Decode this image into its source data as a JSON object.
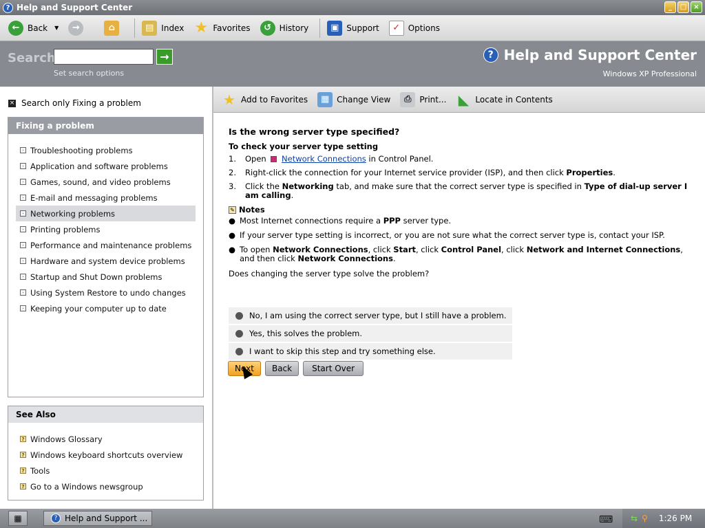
{
  "window": {
    "title": "Help and Support Center"
  },
  "toolbar": {
    "back": "Back",
    "index": "Index",
    "favorites": "Favorites",
    "history": "History",
    "support": "Support",
    "options": "Options"
  },
  "search": {
    "label": "Search",
    "placeholder": "",
    "set_options": "Set search options",
    "app_title": "Help and Support Center",
    "app_sub": "Windows XP Professional"
  },
  "left": {
    "only_check": "Search only Fixing a problem",
    "section_title": "Fixing a problem",
    "items": [
      "Troubleshooting problems",
      "Application and software problems",
      "Games, sound, and video problems",
      "E-mail and messaging problems",
      "Networking problems",
      "Printing problems",
      "Performance and maintenance problems",
      "Hardware and system device problems",
      "Startup and Shut Down problems",
      "Using System Restore to undo changes",
      "Keeping your computer up to date"
    ],
    "see_also_title": "See Also",
    "see_also": [
      "Windows Glossary",
      "Windows keyboard shortcuts overview",
      "Tools",
      "Go to a Windows newsgroup"
    ]
  },
  "content_toolbar": {
    "add_fav": "Add to Favorites",
    "change_view": "Change View",
    "print": "Print...",
    "locate": "Locate in Contents"
  },
  "article": {
    "title": "Is the wrong server type specified?",
    "subtitle": "To check your server type setting",
    "step1_pre": "Open",
    "step1_link": "Network Connections",
    "step1_post": "in Control Panel.",
    "step2_pre": "Right-click the connection for your Internet service provider (ISP), and then click",
    "step2_bold": "Properties",
    "step3_a": "Click the",
    "step3_b": "Networking",
    "step3_c": "tab, and make sure that the correct server type is specified in",
    "step3_d": "Type of dial-up server I am calling",
    "notes": "Notes",
    "note1_a": "Most Internet connections require a",
    "note1_b": "PPP",
    "note1_c": "server type.",
    "note2": "If your server type setting is incorrect, or you are not sure what the correct server type is, contact your ISP.",
    "note3_a": "To open",
    "note3_b": "Network Connections",
    "note3_c": ", click",
    "note3_d": "Start",
    "note3_e": ", click",
    "note3_f": "Control Panel",
    "note3_g": ", click",
    "note3_h": "Network and Internet Connections",
    "note3_i": ", and then click",
    "note3_j": "Network Connections",
    "question": "Does changing the server type solve the problem?"
  },
  "options": [
    "No, I am using the correct server type, but I still have a problem.",
    "Yes, this solves the problem.",
    "I want to skip this step and try something else."
  ],
  "buttons": {
    "next": "Next",
    "back": "Back",
    "start_over": "Start Over"
  },
  "taskbar": {
    "task": "Help and Support ...",
    "time": "1:26 PM"
  }
}
